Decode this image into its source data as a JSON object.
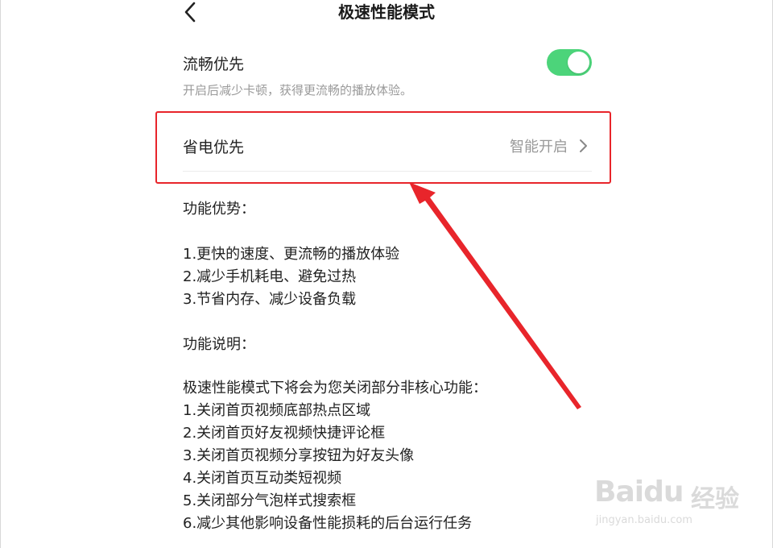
{
  "header": {
    "title": "极速性能模式",
    "back_icon": "chevron-left-icon"
  },
  "settings": {
    "smooth": {
      "label": "流畅优先",
      "description": "开启后减少卡顿，获得更流畅的播放体验。",
      "toggle_on": true,
      "toggle_color": "#4cd47a"
    },
    "power": {
      "label": "省电优先",
      "value": "智能开启",
      "chevron_icon": "chevron-right-icon"
    }
  },
  "advantages": {
    "heading": "功能优势：",
    "items": [
      "1.更快的速度、更流畅的播放体验",
      "2.减少手机耗电、避免过热",
      "3.节省内存、减少设备负载"
    ]
  },
  "explanation": {
    "heading": "功能说明：",
    "intro": "极速性能模式下将会为您关闭部分非核心功能：",
    "items": [
      "1.关闭首页视频底部热点区域",
      "2.关闭首页好友视频快捷评论框",
      "3.关闭首页视频分享按钮为好友头像",
      "4.关闭首页互动类短视频",
      "5.关闭部分气泡样式搜索框",
      "6.减少其他影响设备性能损耗的后台运行任务"
    ]
  },
  "annotation": {
    "highlight_color": "#e8252b"
  },
  "watermark": {
    "brand": "Baidu",
    "brand_cn": "经验",
    "url": "jingyan.baidu.com"
  }
}
